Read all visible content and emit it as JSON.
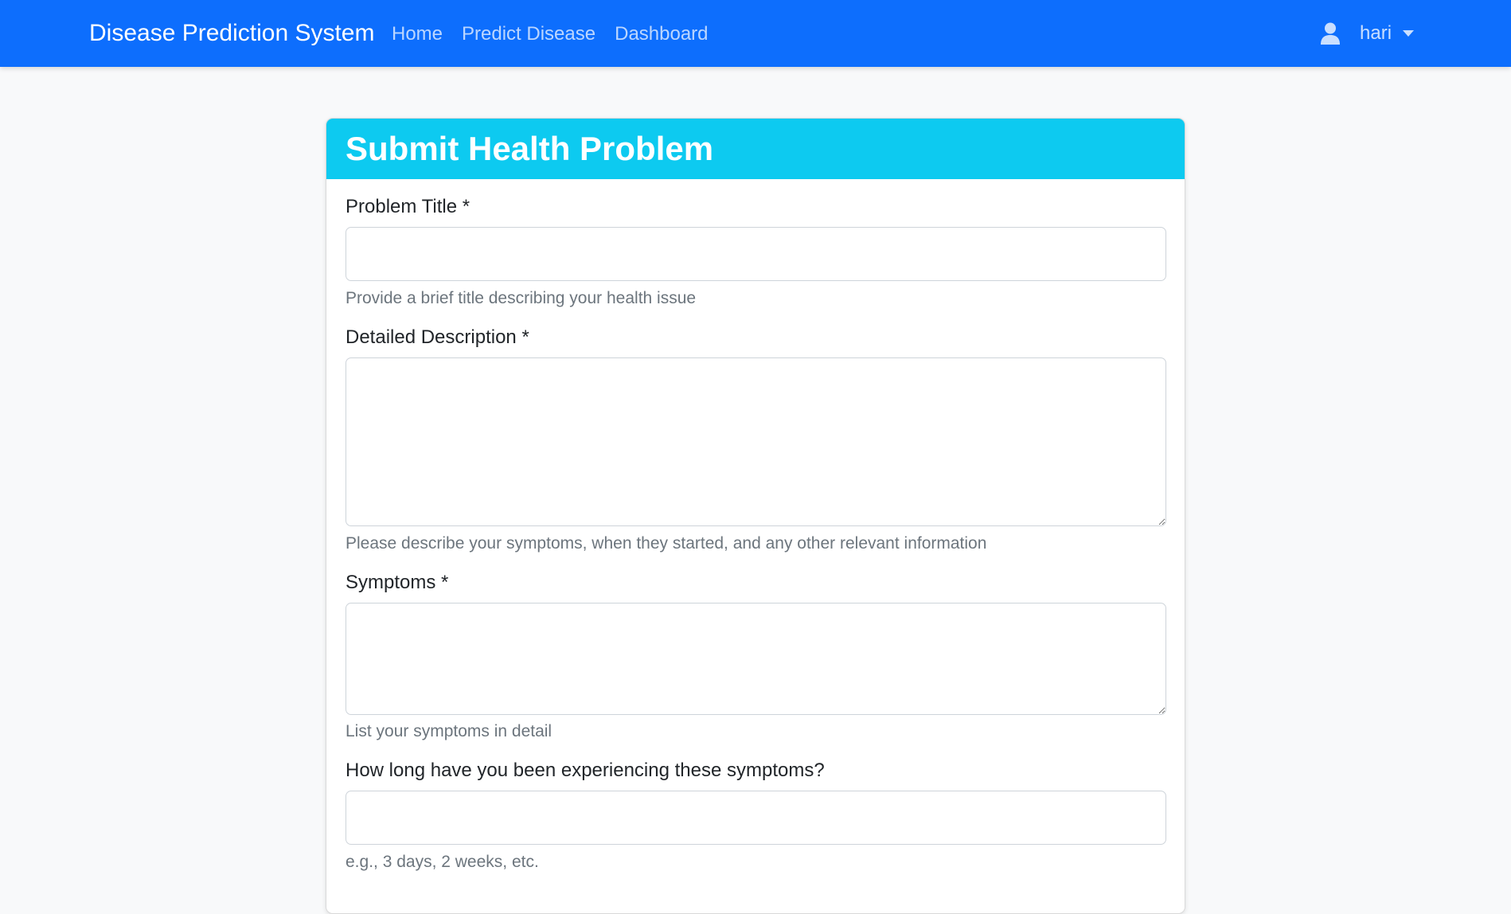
{
  "navbar": {
    "brand": "Disease Prediction System",
    "links": [
      "Home",
      "Predict Disease",
      "Dashboard"
    ],
    "user": {
      "name": "hari",
      "icon": "user-icon"
    }
  },
  "form": {
    "title": "Submit Health Problem",
    "fields": [
      {
        "label": "Problem Title *",
        "value": "",
        "help": "Provide a brief title describing your health issue"
      },
      {
        "label": "Detailed Description *",
        "value": "",
        "help": "Please describe your symptoms, when they started, and any other relevant information"
      },
      {
        "label": "Symptoms *",
        "value": "",
        "help": "List your symptoms in detail"
      },
      {
        "label": "How long have you been experiencing these symptoms?",
        "value": "",
        "help": "e.g., 3 days, 2 weeks, etc."
      }
    ]
  },
  "colors": {
    "navbar_bg": "#0d6efd",
    "card_header_bg": "#0dcaf0",
    "page_bg": "#f8f9fa"
  }
}
